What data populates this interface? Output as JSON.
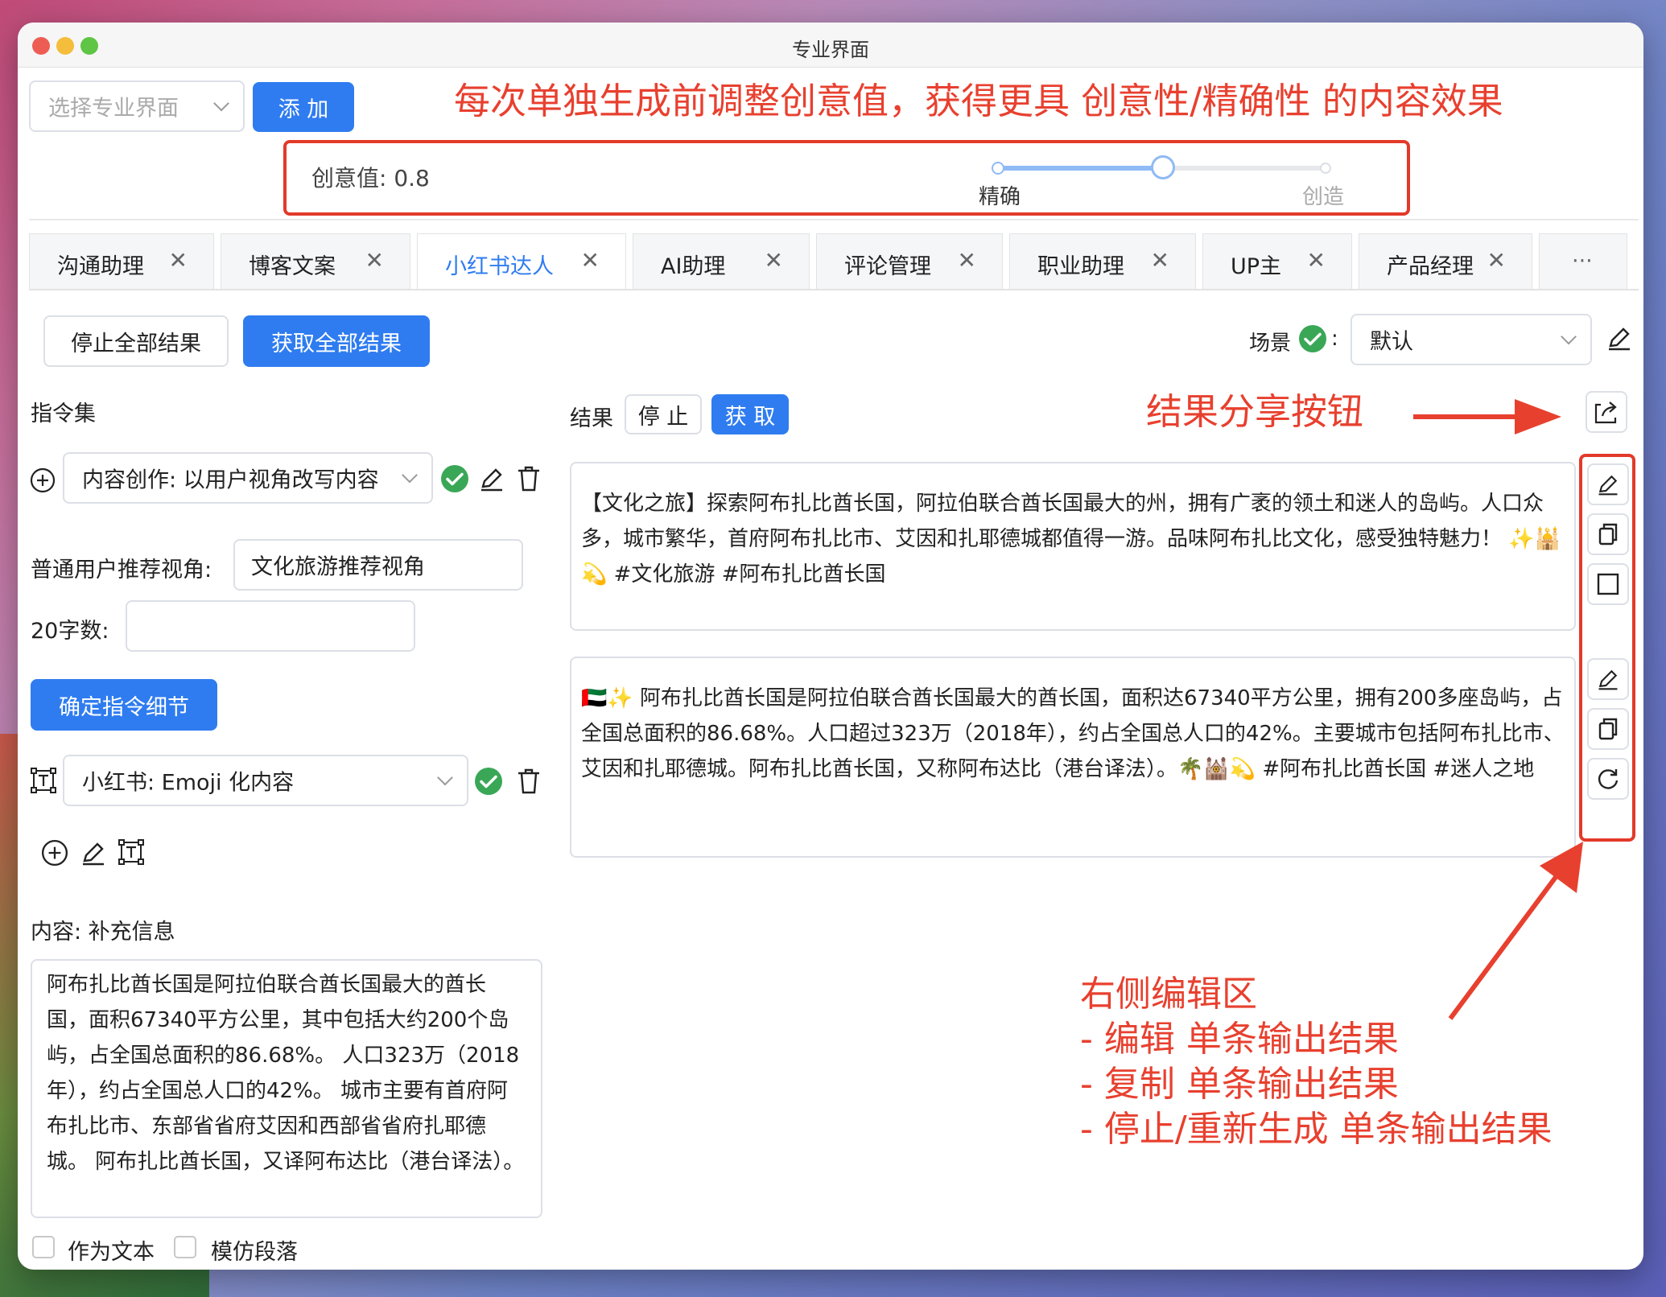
{
  "window": {
    "title": "专业界面"
  },
  "top": {
    "select_placeholder": "选择专业界面",
    "add_button": "添 加",
    "banner_annotation": "每次单独生成前调整创意值，获得更具 创意性/精确性 的内容效果"
  },
  "creativity": {
    "label": "创意值: 0.8",
    "value": 0.8,
    "min_label": "精确",
    "max_label": "创造"
  },
  "tabs": [
    {
      "label": "沟通助理"
    },
    {
      "label": "博客文案"
    },
    {
      "label": "小红书达人",
      "active": true
    },
    {
      "label": "AI助理"
    },
    {
      "label": "评论管理"
    },
    {
      "label": "职业助理"
    },
    {
      "label": "UP主"
    },
    {
      "label": "产品经理"
    }
  ],
  "tabs_more": "···",
  "tab_close": "✕",
  "toolbar": {
    "stop_all": "停止全部结果",
    "get_all": "获取全部结果",
    "scene_label": "场景",
    "scene_colon": ":",
    "scene_value": "默认"
  },
  "left": {
    "instructions_title": "指令集",
    "instruction1": "内容创作: 以用户视角改写内容",
    "field1_label": "普通用户推荐视角:",
    "field1_value": "文化旅游推荐视角",
    "field2_label": "20字数:",
    "field2_value": "",
    "confirm_button": "确定指令细节",
    "instruction2": "小红书: Emoji 化内容",
    "content_label": "内容: 补充信息",
    "content_text": "阿布扎比酋长国是阿拉伯联合酋长国最大的酋长国，面积67340平方公里，其中包括大约200个岛屿，占全国总面积的86.68%。 人口323万（2018年），约占全国总人口的42%。 城市主要有首府阿布扎比市、东部省省府艾因和西部省省府扎耶德城。 阿布扎比酋长国，又译阿布达比（港台译法）。",
    "checkbox1": "作为文本",
    "checkbox2": "模仿段落"
  },
  "results": {
    "label": "结果",
    "stop": "停 止",
    "get": "获 取",
    "share_annotation": "结果分享按钮",
    "result1": "【文化之旅】探索阿布扎比酋长国，阿拉伯联合酋长国最大的州，拥有广袤的领土和迷人的岛屿。人口众多，城市繁华，首府阿布扎比市、艾因和扎耶德城都值得一游。品味阿布扎比文化，感受独特魅力！ ✨🕌💫 #文化旅游 #阿布扎比酋长国",
    "result2": "🇦🇪✨ 阿布扎比酋长国是阿拉伯联合酋长国最大的酋长国，面积达67340平方公里，拥有200多座岛屿，占全国总面积的86.68%。人口超过323万（2018年），约占全国总人口的42%。主要城市包括阿布扎比市、艾因和扎耶德城。阿布扎比酋长国，又称阿布达比（港台译法）。🌴🕍💫 #阿布扎比酋长国 #迷人之地"
  },
  "annotation_right": {
    "line1": "右侧编辑区",
    "line2": "- 编辑 单条输出结果",
    "line3": "- 复制 单条输出结果",
    "line4": "- 停止/重新生成 单条输出结果"
  },
  "colors": {
    "accent": "#2f7cf0",
    "annotation": "#e8402f",
    "check": "#3aa757"
  }
}
